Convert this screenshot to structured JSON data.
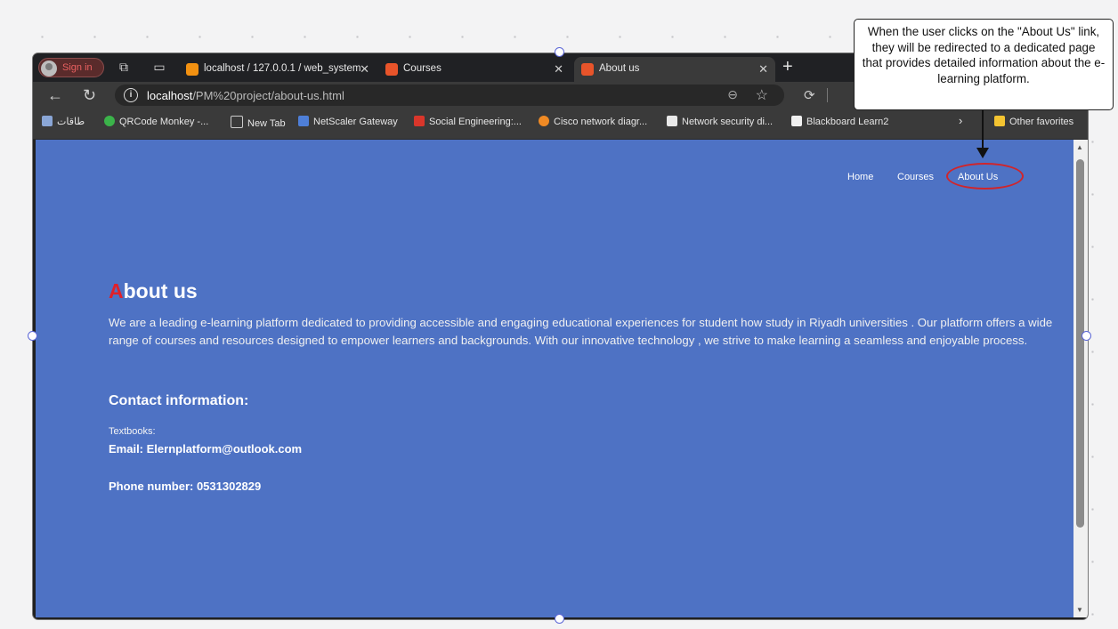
{
  "browser": {
    "profile_label": "Sign in",
    "tabs": [
      {
        "title": "localhost / 127.0.0.1 / web_system"
      },
      {
        "title": "Courses"
      },
      {
        "title": "About us"
      }
    ],
    "url_host": "localhost",
    "url_path": "/PM%20project/about-us.html",
    "bookmarks": [
      {
        "label": "طاقات"
      },
      {
        "label": "QRCode Monkey -..."
      },
      {
        "label": "New Tab"
      },
      {
        "label": "NetScaler Gateway"
      },
      {
        "label": "Social Engineering:..."
      },
      {
        "label": "Cisco network diagr..."
      },
      {
        "label": "Network security di..."
      },
      {
        "label": "Blackboard Learn2"
      }
    ],
    "other_favorites": "Other favorites"
  },
  "site": {
    "nav": {
      "home": "Home",
      "courses": "Courses",
      "about": "About Us"
    },
    "title_first": "A",
    "title_rest": "bout us",
    "intro": "We are a leading e-learning platform dedicated to providing accessible and engaging educational experiences for student how study in Riyadh universities . Our platform offers a wide range of courses and resources designed to empower learners and backgrounds. With our innovative technology , we strive to make learning a seamless and enjoyable process.",
    "contact_heading": "Contact information:",
    "textbooks": "Textbooks:",
    "email": "Email: Elernplatform@outlook.com",
    "phone": "Phone number: 0531302829"
  },
  "annotation": {
    "text": "When the user clicks on the \"About Us\" link, they will be redirected to a dedicated page that provides detailed information about the e-learning platform."
  },
  "colors": {
    "page_bg": "#4e72c4",
    "accent_red": "#e0202a",
    "highlight_ring": "#d0252b"
  }
}
